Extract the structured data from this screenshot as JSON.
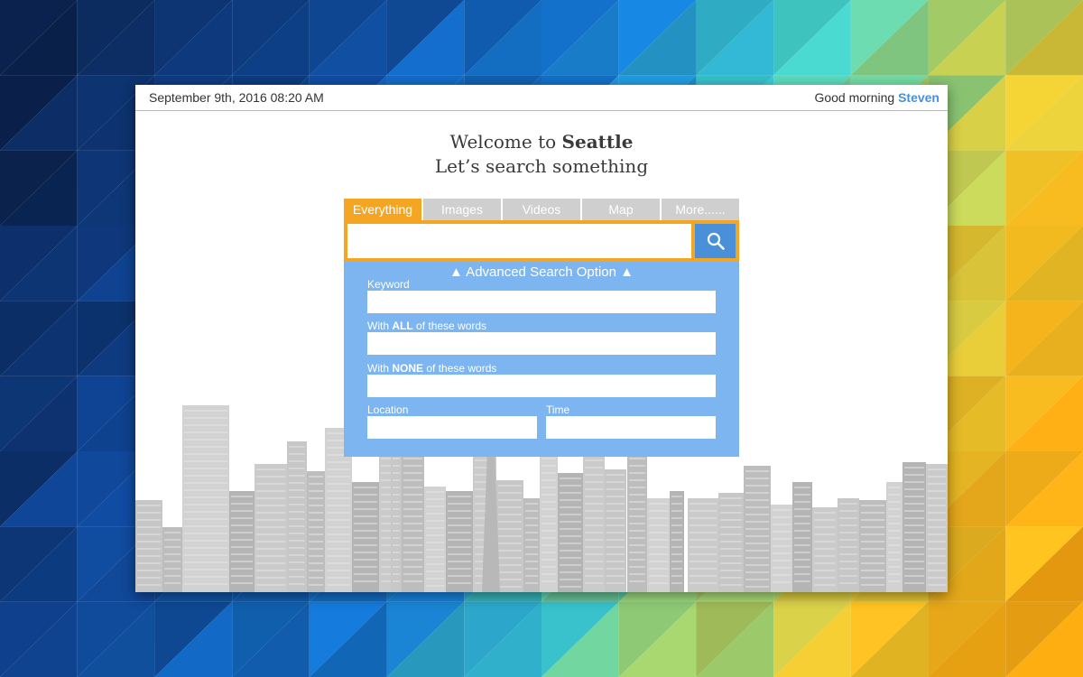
{
  "header": {
    "datetime": "September 9th, 2016 08:20 AM",
    "greeting_prefix": "Good morning",
    "user_name": "Steven"
  },
  "welcome": {
    "line1_prefix": "Welcome to",
    "city": "Seattle",
    "line2": "Let’s search something"
  },
  "tabs": [
    {
      "label": "Everything",
      "active": true
    },
    {
      "label": "Images",
      "active": false
    },
    {
      "label": "Videos",
      "active": false
    },
    {
      "label": "Map",
      "active": false
    },
    {
      "label": "More......",
      "active": false
    }
  ],
  "search": {
    "value": "",
    "placeholder": "",
    "button_icon": "search-icon"
  },
  "advanced": {
    "title": "▲ Advanced Search Option ▲",
    "keyword_label": "Keyword",
    "all_words_label_prefix": "With",
    "all_words_label_bold": "ALL",
    "all_words_label_suffix": "of these words",
    "none_words_label_prefix": "With",
    "none_words_label_bold": "NONE",
    "none_words_label_suffix": "of these words",
    "location_label": "Location",
    "time_label": "Time",
    "keyword_value": "",
    "all_words_value": "",
    "none_words_value": "",
    "location_value": "",
    "time_value": ""
  },
  "colors": {
    "accent_orange": "#f4a623",
    "accent_blue": "#4a90d9",
    "panel_blue": "#7cb5f0",
    "tab_inactive": "#cfcfcf"
  }
}
